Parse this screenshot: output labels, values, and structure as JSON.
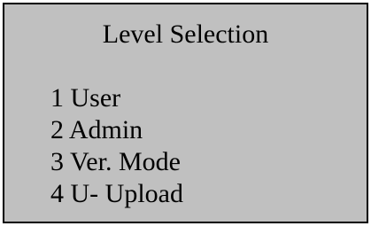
{
  "screen": {
    "title": "Level Selection",
    "menu": [
      {
        "label": "1 User"
      },
      {
        "label": "2 Admin"
      },
      {
        "label": "3 Ver. Mode"
      },
      {
        "label": "4 U- Upload"
      }
    ]
  },
  "colors": {
    "background": "#c0c0c0",
    "border": "#000000",
    "text": "#000000"
  }
}
